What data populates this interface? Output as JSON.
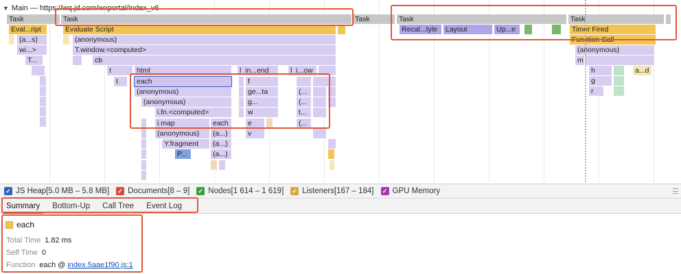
{
  "flame": {
    "main_title": "Main — https://wq.jd.com/wxportal/index_v6",
    "labels": {
      "task1": "Task",
      "task2": "Task",
      "task3": "Task",
      "task4": "Task",
      "task5": "Task",
      "eval_short": "Eval...ript",
      "anon_short": "(a...s)",
      "wi_short": "wi...>",
      "t_short": "T...",
      "evaluate_script": "Evaluate Script",
      "anonymous1": "(anonymous)",
      "twindow": "T.window.<computed>",
      "cb": "cb",
      "t1": "t",
      "html": "html",
      "l_in_end": "l_in...end",
      "l_i_ow": "l_i...ow",
      "t2": "t",
      "each1": "each",
      "anonymous2": "(anonymous)",
      "anonymous3": "(anonymous)",
      "ifn": "i.fn.<computed>",
      "imap": "i.map",
      "each2": "each",
      "anonymous4": "(anonymous)",
      "a1": "(a...)",
      "yfragment": "Y.fragment",
      "a2": "(a...)",
      "p": "P...",
      "a3": "(a...)",
      "f": "f",
      "ge_ta": "ge...ta",
      "g": "g...",
      "w": "w",
      "e": "e",
      "v": "v",
      "p1": "(...",
      "p2": "(...",
      "t3": "t...",
      "p3": "(...",
      "recalc": "Recal...tyle",
      "layout": "Layout",
      "up_e": "Up...e",
      "timer_fired": "Timer Fired",
      "function_call": "Function Call",
      "anonymous5": "(anonymous)",
      "m": "m",
      "h": "h",
      "a_d": "a...d",
      "g2": "g",
      "r": "r"
    }
  },
  "counters": [
    {
      "label": "JS Heap[5.0 MB – 5.8 MB]",
      "color": "#2f66b3",
      "checked": true
    },
    {
      "label": "Documents[8 – 9]",
      "color": "#d64a3b",
      "checked": true
    },
    {
      "label": "Nodes[1 614 – 1 619]",
      "color": "#3d9e3d",
      "checked": true
    },
    {
      "label": "Listeners[167 – 184]",
      "color": "#e0a347",
      "checked": true
    },
    {
      "label": "GPU Memory",
      "color": "#a23ba8",
      "checked": true
    }
  ],
  "tabs": [
    "Summary",
    "Bottom-Up",
    "Call Tree",
    "Event Log"
  ],
  "summary": {
    "title": "each",
    "total_time_label": "Total Time",
    "total_time_value": "1.82 ms",
    "self_time_label": "Self Time",
    "self_time_value": "0",
    "function_label": "Function",
    "function_name": "each @",
    "function_link": "index.5aae1f90.js:1"
  }
}
